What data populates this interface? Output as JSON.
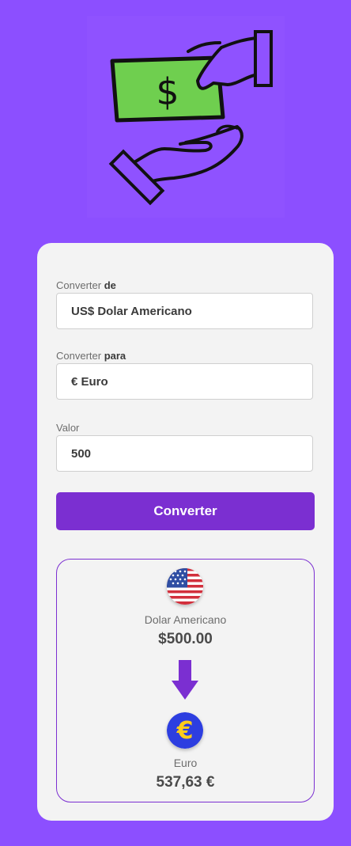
{
  "form": {
    "from_label": "Converter",
    "from_label_strong": "de",
    "from_value": "US$ Dolar Americano",
    "to_label": "Converter",
    "to_label_strong": "para",
    "to_value": "€ Euro",
    "amount_label": "Valor",
    "amount_value": "500",
    "convert_button": "Converter"
  },
  "result": {
    "from_currency_name": "Dolar Americano",
    "from_currency_value": "$500.00",
    "to_currency_name": "Euro",
    "to_currency_value": "537,63 €",
    "from_flag_icon": "us-flag-icon",
    "to_flag_icon": "euro-icon",
    "arrow_icon": "arrow-down-icon"
  },
  "hero": {
    "icon": "money-exchange-icon",
    "currency_symbol": "$"
  },
  "colors": {
    "background": "#8c4fff",
    "card": "#f3f3f3",
    "accent": "#7b2fd1",
    "bill": "#6fcf4f"
  }
}
